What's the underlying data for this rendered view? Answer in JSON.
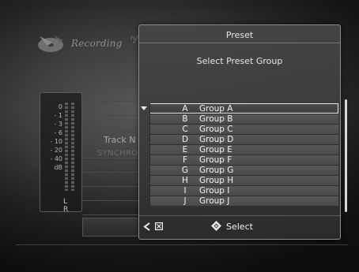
{
  "background_screen": {
    "title": "Recording",
    "meter_scale": [
      "0",
      "- 1",
      "- 3",
      "- 6",
      "- 10",
      "- 20",
      "- 40",
      "dB"
    ],
    "meter_channels": "L R",
    "track_label": "Track N",
    "sync_label": "SYNCHRO"
  },
  "dialog": {
    "title": "Preset",
    "subtitle": "Select Preset Group",
    "groups": [
      {
        "letter": "A",
        "name": "Group A",
        "selected": true
      },
      {
        "letter": "B",
        "name": "Group B"
      },
      {
        "letter": "C",
        "name": "Group C"
      },
      {
        "letter": "D",
        "name": "Group D"
      },
      {
        "letter": "E",
        "name": "Group E"
      },
      {
        "letter": "F",
        "name": "Group F"
      },
      {
        "letter": "G",
        "name": "Group G"
      },
      {
        "letter": "H",
        "name": "Group H"
      },
      {
        "letter": "I",
        "name": "Group I"
      },
      {
        "letter": "J",
        "name": "Group J"
      }
    ],
    "footer": {
      "back_icon": "chevron-left-icon",
      "cancel_icon": "cancel-box-icon",
      "select_icon": "dpad-select-icon",
      "select_label": "Select"
    }
  },
  "colors": {
    "dialog_border": "#8c8c8c",
    "highlight_outline": "#e8e8e8",
    "text": "#f2f2f2"
  }
}
